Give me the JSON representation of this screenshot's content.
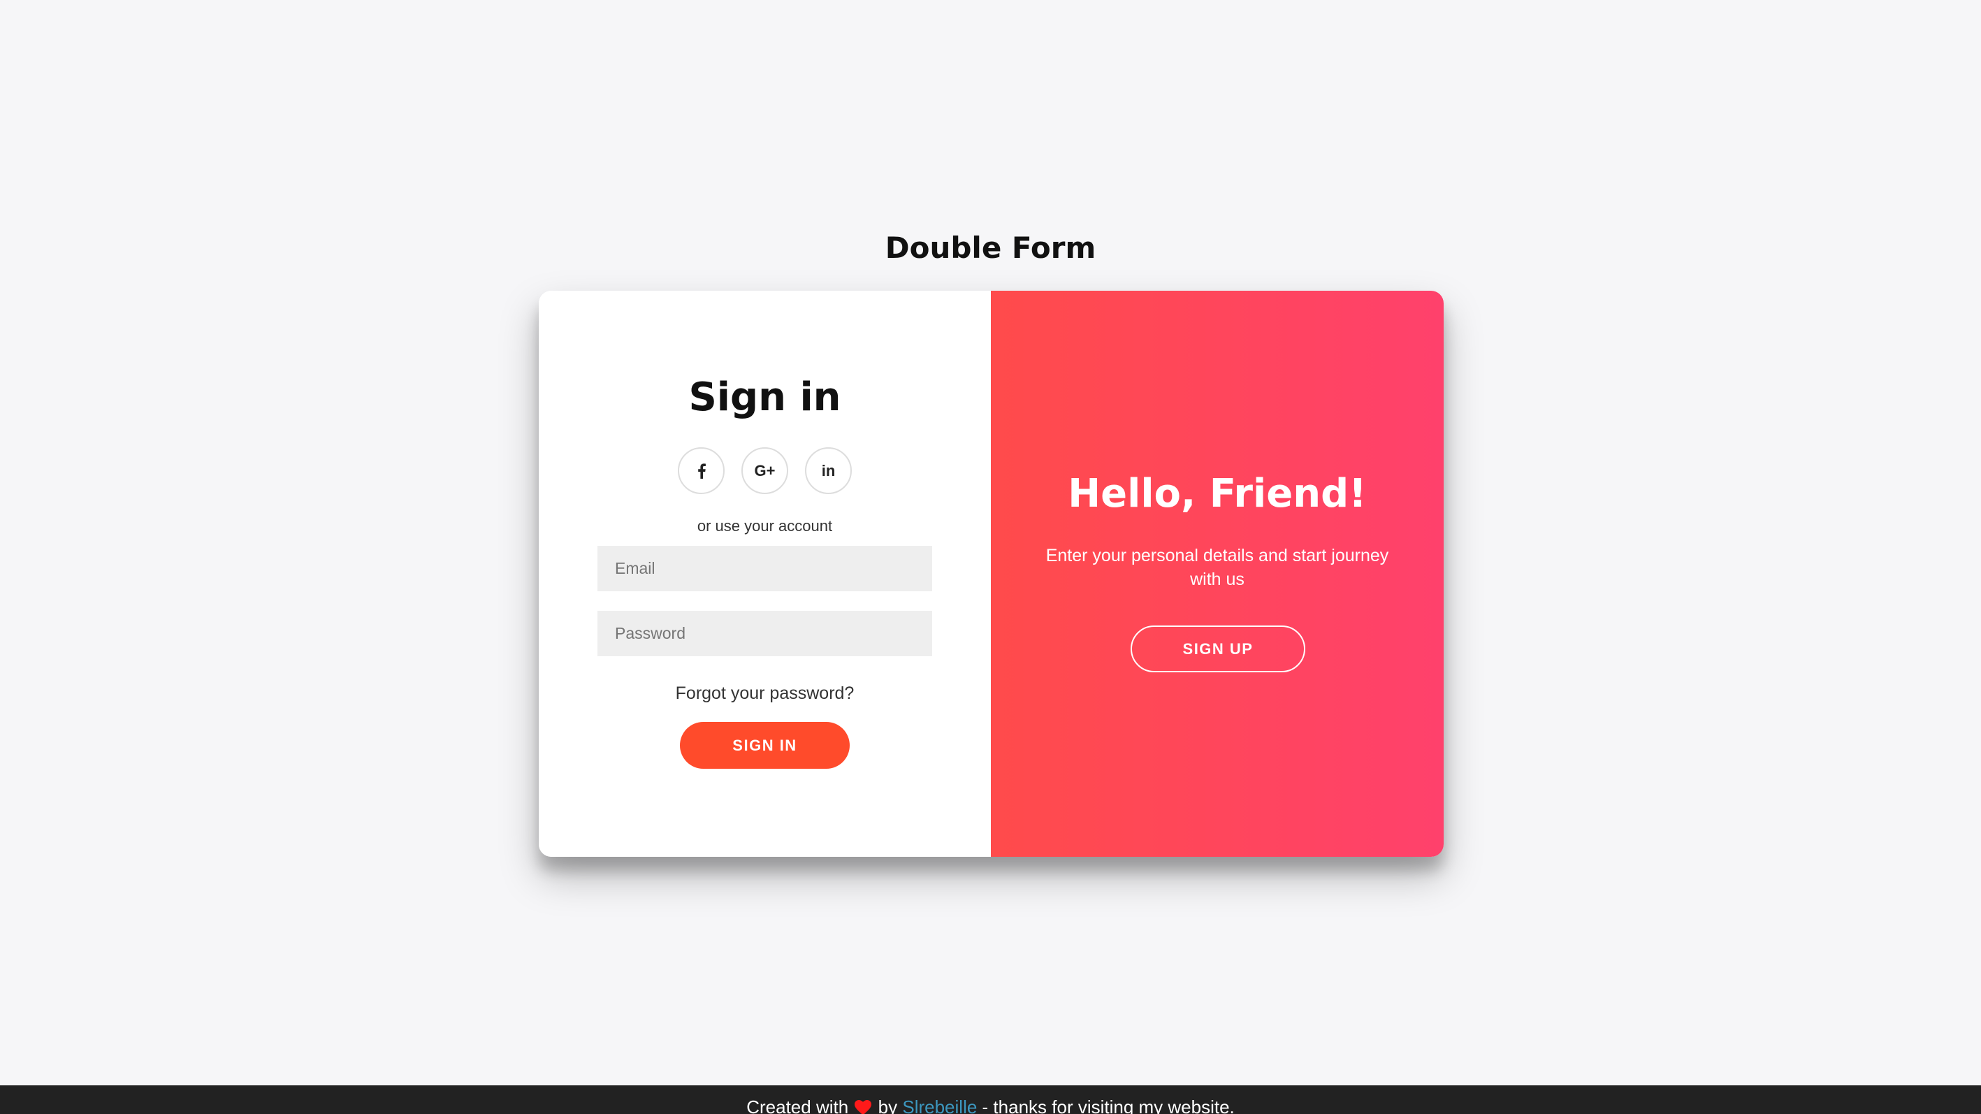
{
  "page": {
    "title": "Double Form"
  },
  "signin": {
    "heading": "Sign in",
    "social": [
      {
        "icon": "facebook-icon",
        "label": "f"
      },
      {
        "icon": "google-plus-icon",
        "label": "G+"
      },
      {
        "icon": "linkedin-icon",
        "label": "in"
      }
    ],
    "alt_text": "or use your account",
    "email_placeholder": "Email",
    "password_placeholder": "Password",
    "forgot_label": "Forgot your password?",
    "button_label": "SIGN IN"
  },
  "overlay": {
    "heading": "Hello, Friend!",
    "text": "Enter your personal details and start journey with us",
    "button_label": "SIGN UP"
  },
  "footer": {
    "prefix": "Created with",
    "by": "by",
    "author": "Slrebeille",
    "suffix": "- thanks for visiting my website."
  },
  "colors": {
    "accent": "#ff4b2b",
    "gradient_start": "#ff4b4b",
    "gradient_end": "#ff416c",
    "background": "#f6f6f8",
    "footer_bg": "#222222",
    "link": "#3c97bf"
  }
}
